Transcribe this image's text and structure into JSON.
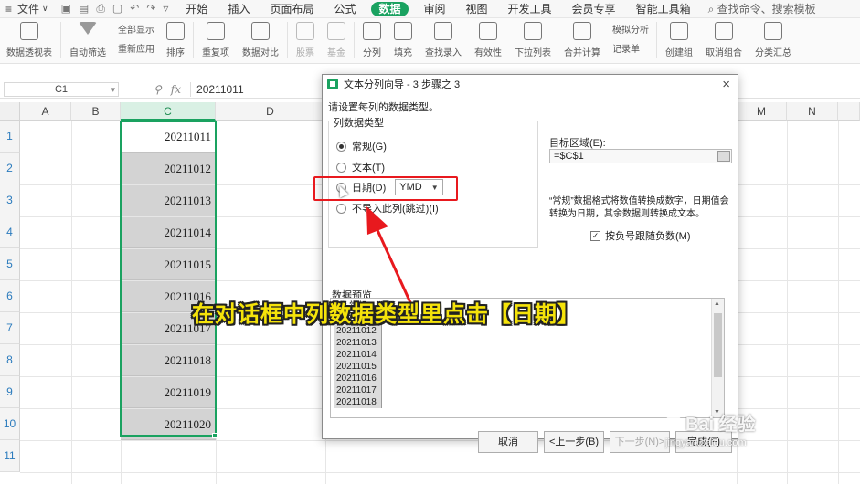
{
  "menubar": {
    "file_label": "文件",
    "tabs": [
      "开始",
      "插入",
      "页面布局",
      "公式",
      "数据",
      "审阅",
      "视图",
      "开发工具",
      "会员专享",
      "智能工具箱"
    ],
    "active_tab": "数据",
    "search_label": "查找命令、搜索模板"
  },
  "ribbon": {
    "items": [
      "数据透视表",
      "自动筛选",
      "全部显示",
      "重新应用",
      "排序",
      "重复项",
      "数据对比",
      "股票",
      "基金",
      "分列",
      "填充",
      "查找录入",
      "有效性",
      "下拉列表",
      "合并计算",
      "模拟分析",
      "记录单",
      "创建组",
      "取消组合",
      "分类汇总"
    ]
  },
  "formula_bar": {
    "name_box": "C1",
    "fx_label": "fx",
    "formula_value": "20211011"
  },
  "sheet": {
    "columns": [
      "A",
      "B",
      "C",
      "D",
      "M",
      "N"
    ],
    "rows": [
      "1",
      "2",
      "3",
      "4",
      "5",
      "6",
      "7",
      "8",
      "9",
      "10",
      "11"
    ],
    "c_values": [
      "20211011",
      "20211012",
      "20211013",
      "20211014",
      "20211015",
      "20211016",
      "20211017",
      "20211018",
      "20211019",
      "20211020"
    ]
  },
  "dialog": {
    "title": "文本分列向导 - 3 步骤之 3",
    "close": "×",
    "prompt": "请设置每列的数据类型。",
    "group_label": "列数据类型",
    "options": [
      "常规(G)",
      "文本(T)",
      "日期(D)",
      "不导入此列(跳过)(I)"
    ],
    "selected_option": "常规(G)",
    "date_format": "YMD",
    "destination_label": "目标区域(E):",
    "destination_value": "=$C$1",
    "note": "“常规”数据格式将数值转换成数字，日期值会转换为日期，其余数据则转换成文本。",
    "checkbox_label": "按负号跟随负数(M)",
    "checkbox_checked": true,
    "preview_label": "数据预览",
    "preview_header": "常规",
    "preview_rows": [
      "20211011",
      "20211012",
      "20211013",
      "20211014",
      "20211015",
      "20211016",
      "20211017",
      "20211018"
    ],
    "buttons": {
      "cancel": "取消",
      "back": "<上一步(B)",
      "next": "下一步(N)>",
      "finish": "完成(F)"
    }
  },
  "annotation": {
    "caption": "在对话框中列数据类型里点击【日期】",
    "highlight_color": "#e8191e",
    "caption_color": "#f5e30a"
  },
  "watermark": {
    "brand": "Bai 经验",
    "url": "jingyan.baidu.com"
  }
}
